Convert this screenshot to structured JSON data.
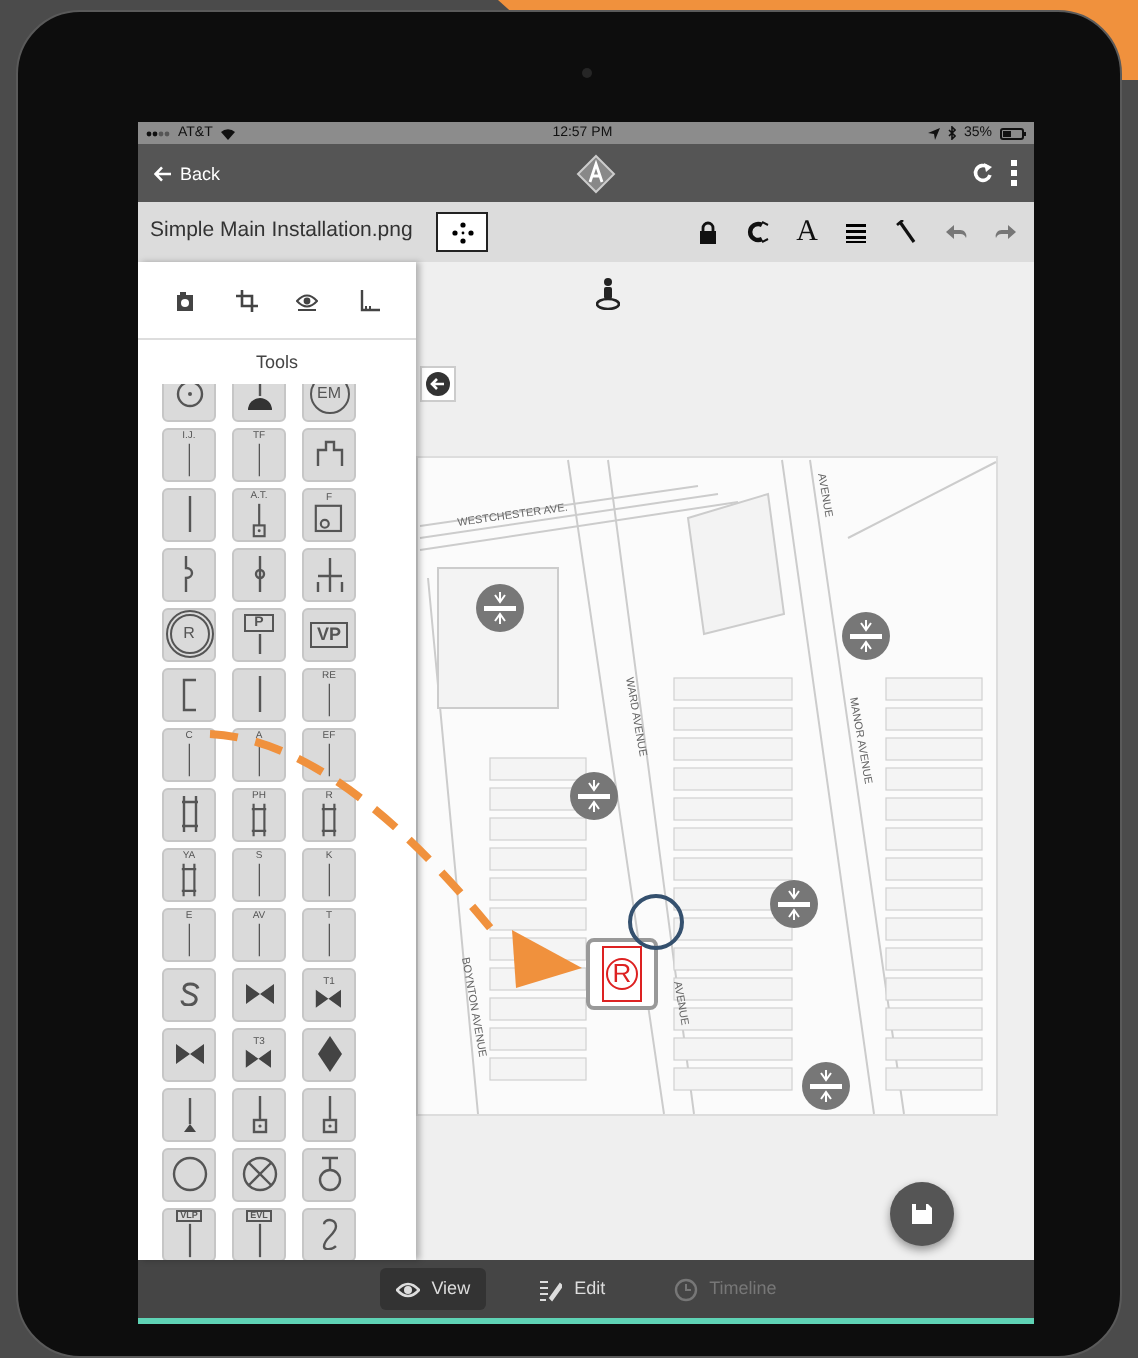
{
  "status_bar": {
    "carrier": "AT&T",
    "time": "12:57 PM",
    "battery": "35%"
  },
  "nav": {
    "back": "Back"
  },
  "toolbar": {
    "file_name": "Simple Main Installation.png",
    "text_tool": "A"
  },
  "tools_panel": {
    "title": "Tools",
    "tools": [
      {
        "kind": "circle-dot"
      },
      {
        "kind": "dome"
      },
      {
        "kind": "circled",
        "label": "EM"
      },
      {
        "kind": "line",
        "label": "I.J."
      },
      {
        "kind": "line",
        "label": "TF"
      },
      {
        "kind": "top-bracket"
      },
      {
        "kind": "line"
      },
      {
        "kind": "line-square",
        "label": "A.T."
      },
      {
        "kind": "circle-box",
        "label": "F"
      },
      {
        "kind": "squiggle"
      },
      {
        "kind": "line-node"
      },
      {
        "kind": "cross"
      },
      {
        "kind": "circled-boxed",
        "label": "R"
      },
      {
        "kind": "sign",
        "label": "P"
      },
      {
        "kind": "framed",
        "label": "VP"
      },
      {
        "kind": "bracket"
      },
      {
        "kind": "line"
      },
      {
        "kind": "line",
        "label": "RE"
      },
      {
        "kind": "line",
        "label": "C"
      },
      {
        "kind": "line",
        "label": "A"
      },
      {
        "kind": "line",
        "label": "EF"
      },
      {
        "kind": "double"
      },
      {
        "kind": "double",
        "label": "PH"
      },
      {
        "kind": "double",
        "label": "R"
      },
      {
        "kind": "double",
        "label": "YA"
      },
      {
        "kind": "line",
        "label": "S"
      },
      {
        "kind": "line",
        "label": "K"
      },
      {
        "kind": "line",
        "label": "E"
      },
      {
        "kind": "line",
        "label": "AV"
      },
      {
        "kind": "line",
        "label": "T"
      },
      {
        "kind": "curve"
      },
      {
        "kind": "bowtie"
      },
      {
        "kind": "bowtie",
        "label": "T1"
      },
      {
        "kind": "bowtie"
      },
      {
        "kind": "bowtie",
        "label": "T3"
      },
      {
        "kind": "diamond"
      },
      {
        "kind": "line-arrow"
      },
      {
        "kind": "line-square"
      },
      {
        "kind": "line-square"
      },
      {
        "kind": "circle"
      },
      {
        "kind": "circle-x"
      },
      {
        "kind": "circle-stem"
      },
      {
        "kind": "tag",
        "label": "VLP"
      },
      {
        "kind": "tag",
        "label": "EVL"
      },
      {
        "kind": "loop"
      }
    ]
  },
  "map": {
    "streets": [
      "WESTCHESTER AVE.",
      "WARD AVENUE",
      "MANOR AVENUE",
      "BOYNTON AVENUE",
      "AVENUE",
      "AVENUE"
    ],
    "placed_symbol": "R"
  },
  "bottom_tabs": [
    {
      "label": "View",
      "selected": true,
      "disabled": false
    },
    {
      "label": "Edit",
      "selected": false,
      "disabled": false
    },
    {
      "label": "Timeline",
      "selected": false,
      "disabled": true
    }
  ]
}
